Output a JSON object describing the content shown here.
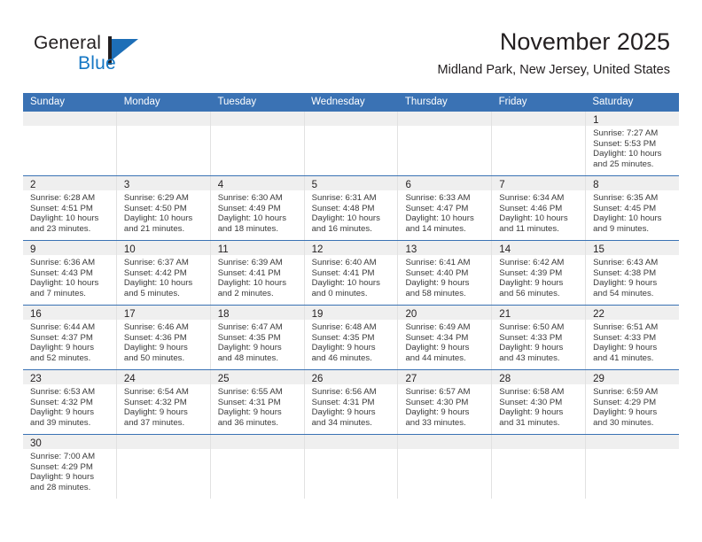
{
  "brand": {
    "name_part1": "General",
    "name_part2": "Blue",
    "logo_icon": "blue-triangle-logo-icon",
    "color_dark": "#231f20",
    "color_blue": "#1577c4"
  },
  "header": {
    "title": "November 2025",
    "subtitle": "Midland Park, New Jersey, United States"
  },
  "theme": {
    "header_row_bg": "#3a72b4",
    "daynum_band_bg": "#efefef",
    "week_divider": "#3a72b4",
    "cell_border": "#e2e2e2",
    "text": "#231f20"
  },
  "labels": {
    "sunrise_prefix": "Sunrise:",
    "sunset_prefix": "Sunset:",
    "daylight_prefix": "Daylight:"
  },
  "day_headers": [
    "Sunday",
    "Monday",
    "Tuesday",
    "Wednesday",
    "Thursday",
    "Friday",
    "Saturday"
  ],
  "weeks": [
    [
      {
        "empty": true
      },
      {
        "empty": true
      },
      {
        "empty": true
      },
      {
        "empty": true
      },
      {
        "empty": true
      },
      {
        "empty": true
      },
      {
        "day": "1",
        "sunrise": "Sunrise: 7:27 AM",
        "sunset": "Sunset: 5:53 PM",
        "daylight_line1": "Daylight: 10 hours",
        "daylight_line2": "and 25 minutes."
      }
    ],
    [
      {
        "day": "2",
        "sunrise": "Sunrise: 6:28 AM",
        "sunset": "Sunset: 4:51 PM",
        "daylight_line1": "Daylight: 10 hours",
        "daylight_line2": "and 23 minutes."
      },
      {
        "day": "3",
        "sunrise": "Sunrise: 6:29 AM",
        "sunset": "Sunset: 4:50 PM",
        "daylight_line1": "Daylight: 10 hours",
        "daylight_line2": "and 21 minutes."
      },
      {
        "day": "4",
        "sunrise": "Sunrise: 6:30 AM",
        "sunset": "Sunset: 4:49 PM",
        "daylight_line1": "Daylight: 10 hours",
        "daylight_line2": "and 18 minutes."
      },
      {
        "day": "5",
        "sunrise": "Sunrise: 6:31 AM",
        "sunset": "Sunset: 4:48 PM",
        "daylight_line1": "Daylight: 10 hours",
        "daylight_line2": "and 16 minutes."
      },
      {
        "day": "6",
        "sunrise": "Sunrise: 6:33 AM",
        "sunset": "Sunset: 4:47 PM",
        "daylight_line1": "Daylight: 10 hours",
        "daylight_line2": "and 14 minutes."
      },
      {
        "day": "7",
        "sunrise": "Sunrise: 6:34 AM",
        "sunset": "Sunset: 4:46 PM",
        "daylight_line1": "Daylight: 10 hours",
        "daylight_line2": "and 11 minutes."
      },
      {
        "day": "8",
        "sunrise": "Sunrise: 6:35 AM",
        "sunset": "Sunset: 4:45 PM",
        "daylight_line1": "Daylight: 10 hours",
        "daylight_line2": "and 9 minutes."
      }
    ],
    [
      {
        "day": "9",
        "sunrise": "Sunrise: 6:36 AM",
        "sunset": "Sunset: 4:43 PM",
        "daylight_line1": "Daylight: 10 hours",
        "daylight_line2": "and 7 minutes."
      },
      {
        "day": "10",
        "sunrise": "Sunrise: 6:37 AM",
        "sunset": "Sunset: 4:42 PM",
        "daylight_line1": "Daylight: 10 hours",
        "daylight_line2": "and 5 minutes."
      },
      {
        "day": "11",
        "sunrise": "Sunrise: 6:39 AM",
        "sunset": "Sunset: 4:41 PM",
        "daylight_line1": "Daylight: 10 hours",
        "daylight_line2": "and 2 minutes."
      },
      {
        "day": "12",
        "sunrise": "Sunrise: 6:40 AM",
        "sunset": "Sunset: 4:41 PM",
        "daylight_line1": "Daylight: 10 hours",
        "daylight_line2": "and 0 minutes."
      },
      {
        "day": "13",
        "sunrise": "Sunrise: 6:41 AM",
        "sunset": "Sunset: 4:40 PM",
        "daylight_line1": "Daylight: 9 hours",
        "daylight_line2": "and 58 minutes."
      },
      {
        "day": "14",
        "sunrise": "Sunrise: 6:42 AM",
        "sunset": "Sunset: 4:39 PM",
        "daylight_line1": "Daylight: 9 hours",
        "daylight_line2": "and 56 minutes."
      },
      {
        "day": "15",
        "sunrise": "Sunrise: 6:43 AM",
        "sunset": "Sunset: 4:38 PM",
        "daylight_line1": "Daylight: 9 hours",
        "daylight_line2": "and 54 minutes."
      }
    ],
    [
      {
        "day": "16",
        "sunrise": "Sunrise: 6:44 AM",
        "sunset": "Sunset: 4:37 PM",
        "daylight_line1": "Daylight: 9 hours",
        "daylight_line2": "and 52 minutes."
      },
      {
        "day": "17",
        "sunrise": "Sunrise: 6:46 AM",
        "sunset": "Sunset: 4:36 PM",
        "daylight_line1": "Daylight: 9 hours",
        "daylight_line2": "and 50 minutes."
      },
      {
        "day": "18",
        "sunrise": "Sunrise: 6:47 AM",
        "sunset": "Sunset: 4:35 PM",
        "daylight_line1": "Daylight: 9 hours",
        "daylight_line2": "and 48 minutes."
      },
      {
        "day": "19",
        "sunrise": "Sunrise: 6:48 AM",
        "sunset": "Sunset: 4:35 PM",
        "daylight_line1": "Daylight: 9 hours",
        "daylight_line2": "and 46 minutes."
      },
      {
        "day": "20",
        "sunrise": "Sunrise: 6:49 AM",
        "sunset": "Sunset: 4:34 PM",
        "daylight_line1": "Daylight: 9 hours",
        "daylight_line2": "and 44 minutes."
      },
      {
        "day": "21",
        "sunrise": "Sunrise: 6:50 AM",
        "sunset": "Sunset: 4:33 PM",
        "daylight_line1": "Daylight: 9 hours",
        "daylight_line2": "and 43 minutes."
      },
      {
        "day": "22",
        "sunrise": "Sunrise: 6:51 AM",
        "sunset": "Sunset: 4:33 PM",
        "daylight_line1": "Daylight: 9 hours",
        "daylight_line2": "and 41 minutes."
      }
    ],
    [
      {
        "day": "23",
        "sunrise": "Sunrise: 6:53 AM",
        "sunset": "Sunset: 4:32 PM",
        "daylight_line1": "Daylight: 9 hours",
        "daylight_line2": "and 39 minutes."
      },
      {
        "day": "24",
        "sunrise": "Sunrise: 6:54 AM",
        "sunset": "Sunset: 4:32 PM",
        "daylight_line1": "Daylight: 9 hours",
        "daylight_line2": "and 37 minutes."
      },
      {
        "day": "25",
        "sunrise": "Sunrise: 6:55 AM",
        "sunset": "Sunset: 4:31 PM",
        "daylight_line1": "Daylight: 9 hours",
        "daylight_line2": "and 36 minutes."
      },
      {
        "day": "26",
        "sunrise": "Sunrise: 6:56 AM",
        "sunset": "Sunset: 4:31 PM",
        "daylight_line1": "Daylight: 9 hours",
        "daylight_line2": "and 34 minutes."
      },
      {
        "day": "27",
        "sunrise": "Sunrise: 6:57 AM",
        "sunset": "Sunset: 4:30 PM",
        "daylight_line1": "Daylight: 9 hours",
        "daylight_line2": "and 33 minutes."
      },
      {
        "day": "28",
        "sunrise": "Sunrise: 6:58 AM",
        "sunset": "Sunset: 4:30 PM",
        "daylight_line1": "Daylight: 9 hours",
        "daylight_line2": "and 31 minutes."
      },
      {
        "day": "29",
        "sunrise": "Sunrise: 6:59 AM",
        "sunset": "Sunset: 4:29 PM",
        "daylight_line1": "Daylight: 9 hours",
        "daylight_line2": "and 30 minutes."
      }
    ],
    [
      {
        "day": "30",
        "sunrise": "Sunrise: 7:00 AM",
        "sunset": "Sunset: 4:29 PM",
        "daylight_line1": "Daylight: 9 hours",
        "daylight_line2": "and 28 minutes."
      },
      {
        "empty": true
      },
      {
        "empty": true
      },
      {
        "empty": true
      },
      {
        "empty": true
      },
      {
        "empty": true
      },
      {
        "empty": true
      }
    ]
  ]
}
